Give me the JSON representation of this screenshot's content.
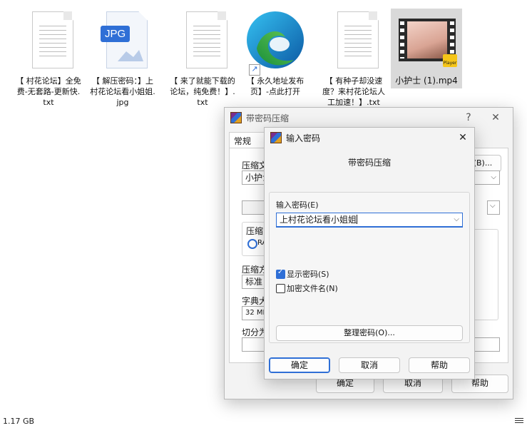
{
  "desktop": {
    "files": [
      {
        "name": "【 村花论坛】全免费-无套路-更新快.txt",
        "icon": "text-file-icon"
      },
      {
        "name": "【 解压密码：】上村花论坛看小姐姐.jpg",
        "icon": "jpg-file-icon",
        "badge": "JPG"
      },
      {
        "name": "【 来了就能下载的论坛，纯免费！】.txt",
        "icon": "text-file-icon"
      },
      {
        "name": "【 永久地址发布页】-点此打开",
        "icon": "edge-shortcut-icon"
      },
      {
        "name": "【 有种子却没速度？来村花论坛人工加速！】.txt",
        "icon": "text-file-icon"
      },
      {
        "name": "小护士 (1).mp4",
        "icon": "video-file-icon",
        "badge": "Player"
      }
    ]
  },
  "status_bar": {
    "size": "1.17 GB"
  },
  "archive_window": {
    "title": "带密码压缩",
    "help_glyph": "?",
    "close_glyph": "✕",
    "tab_general": "常规",
    "archive_name_label": "压缩文",
    "browse_button": "(B)...",
    "archive_name_value": "小护士",
    "compression_label": "压缩",
    "format_radio_text": "RA",
    "method_label": "压缩方",
    "method_value": "标准",
    "dict_label": "字典大",
    "dict_value": "32 MB",
    "split_label": "切分为",
    "paren_fragment": ")",
    "ok_button": "确定",
    "cancel_button": "取消",
    "help_button": "帮助"
  },
  "password_dialog": {
    "title": "输入密码",
    "close_glyph": "✕",
    "heading": "带密码压缩",
    "password_label": "输入密码(E)",
    "password_value": "上村花论坛看小姐姐",
    "show_password_label": "显示密码(S)",
    "show_password_checked": true,
    "encrypt_names_label": "加密文件名(N)",
    "encrypt_names_checked": false,
    "organize_button": "整理密码(O)...",
    "ok_button": "确定",
    "cancel_button": "取消",
    "help_button": "帮助"
  },
  "colors": {
    "accent": "#2f6fd6",
    "dialog_bg": "#f3f3f3",
    "selection": "#d9d9d9"
  }
}
